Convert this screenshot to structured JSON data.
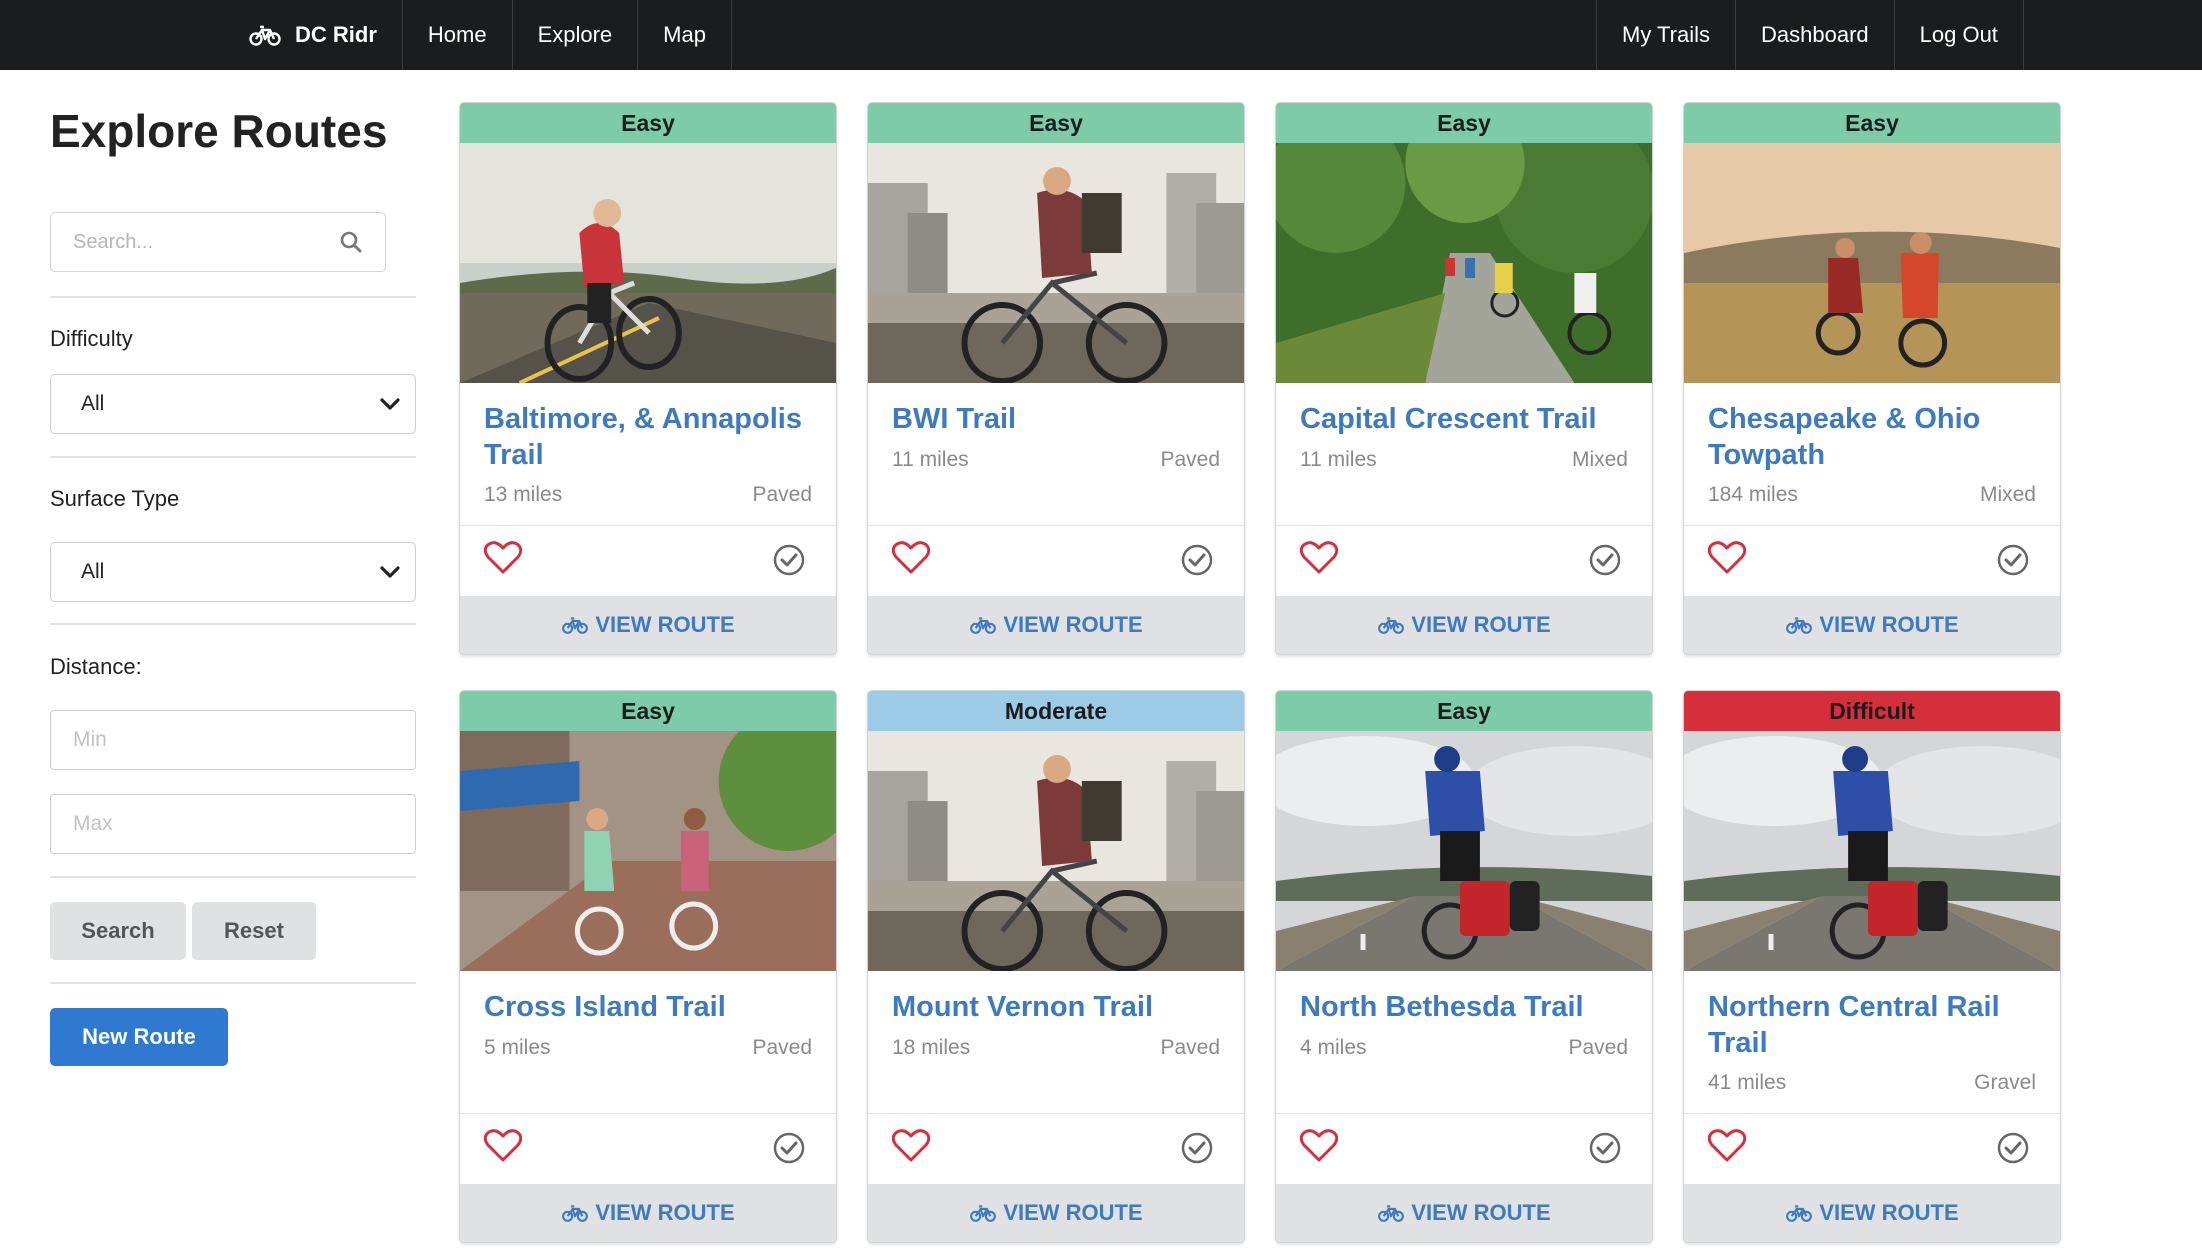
{
  "nav": {
    "brand": "DC Ridr",
    "left_items": [
      "Home",
      "Explore",
      "Map"
    ],
    "right_items": [
      "My Trails",
      "Dashboard",
      "Log Out"
    ]
  },
  "sidebar": {
    "title": "Explore Routes",
    "search_placeholder": "Search...",
    "difficulty_label": "Difficulty",
    "difficulty_value": "All",
    "surface_label": "Surface Type",
    "surface_value": "All",
    "distance_label": "Distance:",
    "min_placeholder": "Min",
    "max_placeholder": "Max",
    "search_button": "Search",
    "reset_button": "Reset",
    "new_route_button": "New Route"
  },
  "colors": {
    "easy": "#7dcba9",
    "moderate": "#9ccbe8",
    "difficult": "#d42f3a",
    "link": "#3e7ac0",
    "navbar": "#1b1c1d",
    "primary_button": "#2f79d0"
  },
  "view_route_label": "VIEW ROUTE",
  "routes": [
    {
      "difficulty": "Easy",
      "name": "Baltimore, & Annapolis Trail",
      "miles": "13 miles",
      "surface": "Paved",
      "image": "road-cyclist-red-jersey"
    },
    {
      "difficulty": "Easy",
      "name": "BWI Trail",
      "miles": "11 miles",
      "surface": "Paved",
      "image": "city-cyclist-backpack"
    },
    {
      "difficulty": "Easy",
      "name": "Capital Crescent Trail",
      "miles": "11 miles",
      "surface": "Mixed",
      "image": "forest-path-group-riders"
    },
    {
      "difficulty": "Easy",
      "name": "Chesapeake & Ohio Towpath",
      "miles": "184 miles",
      "surface": "Mixed",
      "image": "field-mountain-bikers"
    },
    {
      "difficulty": "Easy",
      "name": "Cross Island Trail",
      "miles": "5 miles",
      "surface": "Paved",
      "image": "street-couple-cruisers"
    },
    {
      "difficulty": "Moderate",
      "name": "Mount Vernon Trail",
      "miles": "18 miles",
      "surface": "Paved",
      "image": "city-cyclist-backpack"
    },
    {
      "difficulty": "Easy",
      "name": "North Bethesda Trail",
      "miles": "4 miles",
      "surface": "Paved",
      "image": "touring-cyclist-panniers"
    },
    {
      "difficulty": "Difficult",
      "name": "Northern Central Rail Trail",
      "miles": "41 miles",
      "surface": "Gravel",
      "image": "touring-cyclist-panniers"
    }
  ]
}
